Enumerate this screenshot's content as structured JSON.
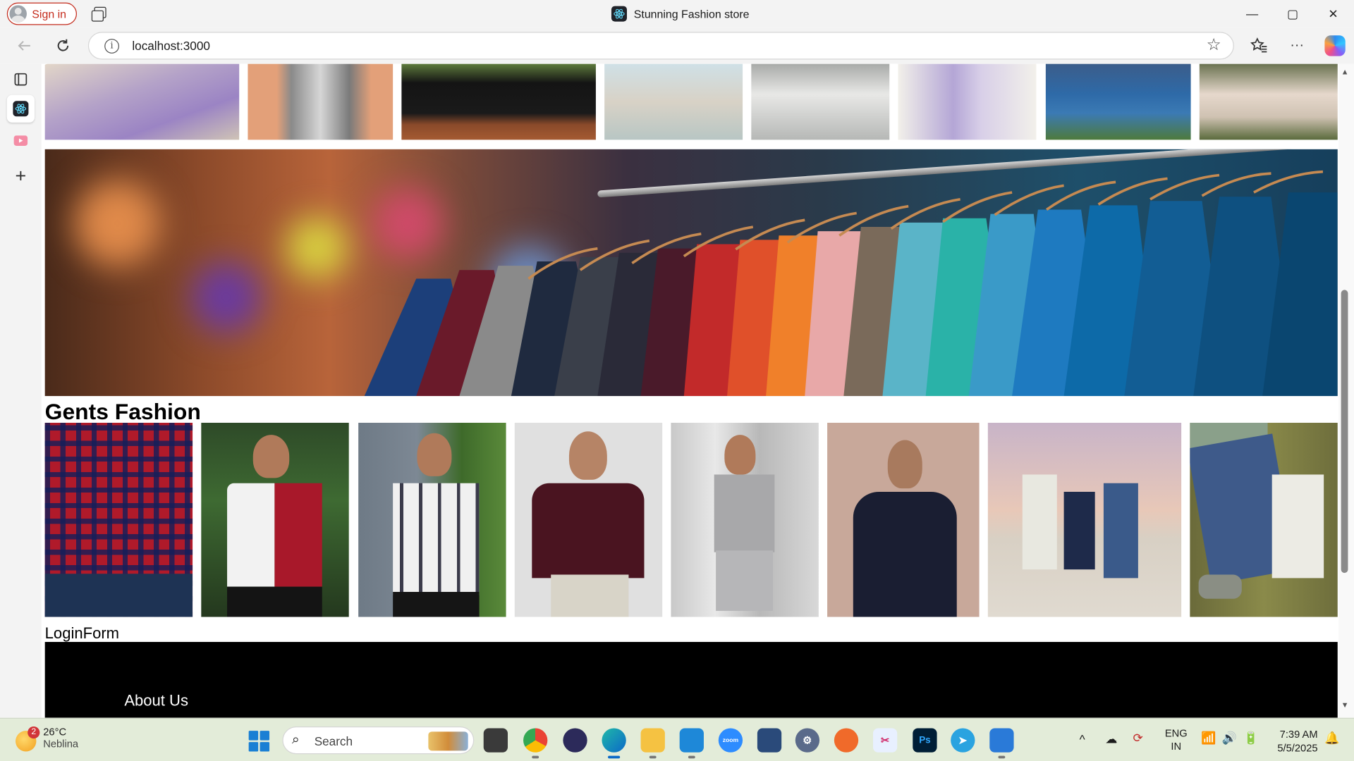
{
  "browser": {
    "sign_in": "Sign in",
    "window_title": "Stunning Fashion store",
    "url": "localhost:3000",
    "controls": {
      "minimize": "—",
      "maximize": "▢",
      "close": "✕"
    }
  },
  "page": {
    "gents_title": "Gents Fashion",
    "login_link": "LoginForm",
    "footer_about": "About Us"
  },
  "taskbar": {
    "weather_temp": "26°C",
    "weather_desc": "Neblina",
    "weather_badge": "2",
    "search_label": "Search",
    "lang_top": "ENG",
    "lang_bottom": "IN",
    "time": "7:39 AM",
    "date": "5/5/2025"
  },
  "colors": {
    "edge_accent": "#0078d4",
    "sign_in_red": "#c42b1c",
    "footer_bg": "#000000",
    "taskbar_bg": "#e3ecd9"
  }
}
